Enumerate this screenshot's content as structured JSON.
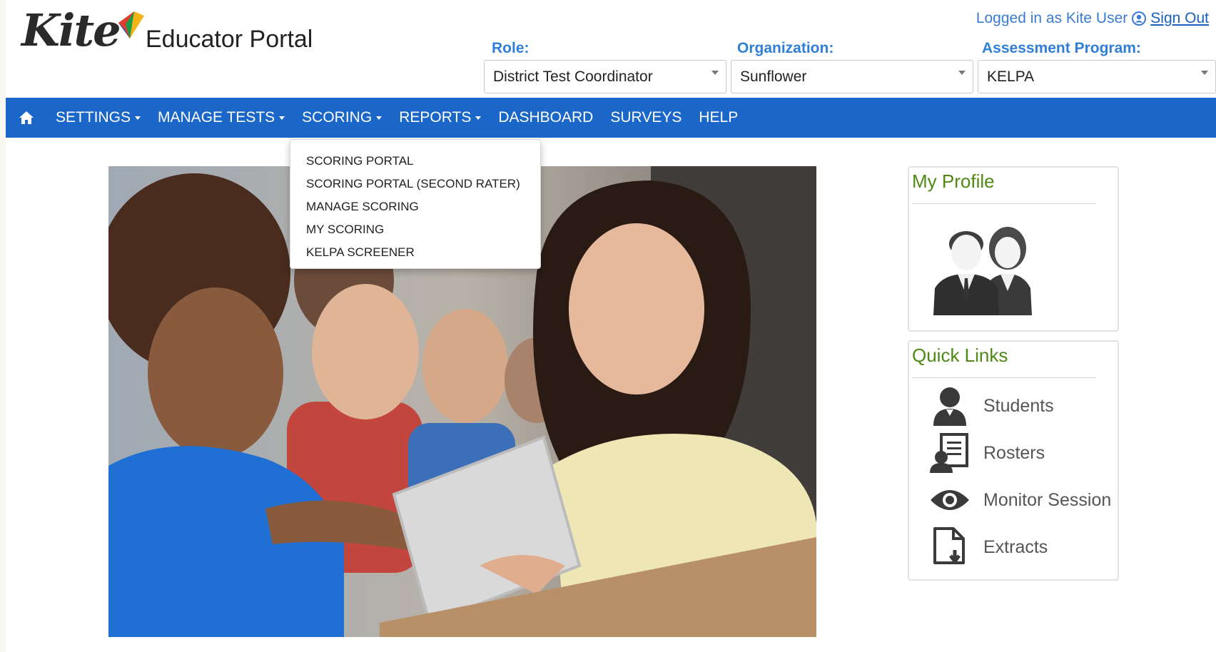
{
  "header": {
    "logo_text": "Kite",
    "portal_title": "Educator Portal",
    "login_text": "Logged in as Kite User",
    "sign_out_label": "Sign Out"
  },
  "filters": {
    "role": {
      "label": "Role:",
      "value": "District Test Coordinator"
    },
    "organization": {
      "label": "Organization:",
      "value": "Sunflower"
    },
    "program": {
      "label": "Assessment Program:",
      "value": "KELPA"
    }
  },
  "nav": {
    "items": [
      {
        "label": "SETTINGS",
        "has_dropdown": true
      },
      {
        "label": "MANAGE TESTS",
        "has_dropdown": true
      },
      {
        "label": "SCORING",
        "has_dropdown": true
      },
      {
        "label": "REPORTS",
        "has_dropdown": true
      },
      {
        "label": "DASHBOARD",
        "has_dropdown": false
      },
      {
        "label": "SURVEYS",
        "has_dropdown": false
      },
      {
        "label": "HELP",
        "has_dropdown": false
      }
    ],
    "open_menu": "SCORING"
  },
  "scoring_menu": [
    "SCORING PORTAL",
    "SCORING PORTAL (SECOND RATER)",
    "MANAGE SCORING",
    "MY SCORING",
    "KELPA SCREENER"
  ],
  "profile": {
    "title": "My Profile"
  },
  "quick_links": {
    "title": "Quick Links",
    "items": [
      {
        "label": "Students",
        "icon": "student-icon"
      },
      {
        "label": "Rosters",
        "icon": "roster-icon"
      },
      {
        "label": "Monitor Session",
        "icon": "eye-icon"
      },
      {
        "label": "Extracts",
        "icon": "extract-file-icon"
      }
    ]
  },
  "colors": {
    "nav_bg": "#1b66c9",
    "label_blue": "#2f7fd8",
    "panel_title_green": "#4d8a13"
  }
}
